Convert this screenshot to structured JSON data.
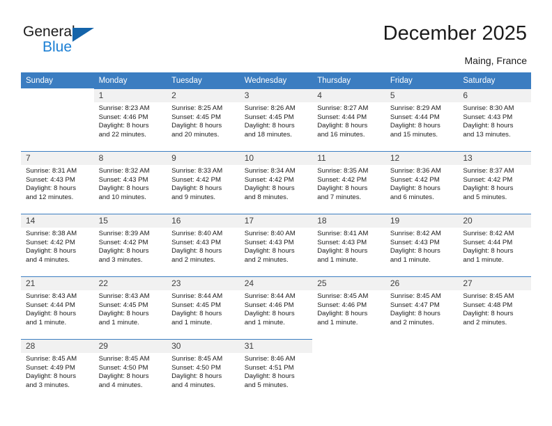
{
  "brand": {
    "name_part1": "General",
    "name_part2": "Blue",
    "triangle_color": "#1464aa",
    "blue_color": "#1b7fd4"
  },
  "header": {
    "title": "December 2025",
    "location": "Maing, France"
  },
  "theme": {
    "header_row_bg": "#3b7dc1",
    "day_number_bg": "#f1f1f1",
    "text_color": "#1b1b1b"
  },
  "weekdays": [
    "Sunday",
    "Monday",
    "Tuesday",
    "Wednesday",
    "Thursday",
    "Friday",
    "Saturday"
  ],
  "weeks": [
    [
      {
        "day": "",
        "sunrise": "",
        "sunset": "",
        "daylight1": "",
        "daylight2": "",
        "empty": true
      },
      {
        "day": "1",
        "sunrise": "Sunrise: 8:23 AM",
        "sunset": "Sunset: 4:46 PM",
        "daylight1": "Daylight: 8 hours",
        "daylight2": "and 22 minutes.",
        "empty": false
      },
      {
        "day": "2",
        "sunrise": "Sunrise: 8:25 AM",
        "sunset": "Sunset: 4:45 PM",
        "daylight1": "Daylight: 8 hours",
        "daylight2": "and 20 minutes.",
        "empty": false
      },
      {
        "day": "3",
        "sunrise": "Sunrise: 8:26 AM",
        "sunset": "Sunset: 4:45 PM",
        "daylight1": "Daylight: 8 hours",
        "daylight2": "and 18 minutes.",
        "empty": false
      },
      {
        "day": "4",
        "sunrise": "Sunrise: 8:27 AM",
        "sunset": "Sunset: 4:44 PM",
        "daylight1": "Daylight: 8 hours",
        "daylight2": "and 16 minutes.",
        "empty": false
      },
      {
        "day": "5",
        "sunrise": "Sunrise: 8:29 AM",
        "sunset": "Sunset: 4:44 PM",
        "daylight1": "Daylight: 8 hours",
        "daylight2": "and 15 minutes.",
        "empty": false
      },
      {
        "day": "6",
        "sunrise": "Sunrise: 8:30 AM",
        "sunset": "Sunset: 4:43 PM",
        "daylight1": "Daylight: 8 hours",
        "daylight2": "and 13 minutes.",
        "empty": false
      }
    ],
    [
      {
        "day": "7",
        "sunrise": "Sunrise: 8:31 AM",
        "sunset": "Sunset: 4:43 PM",
        "daylight1": "Daylight: 8 hours",
        "daylight2": "and 12 minutes.",
        "empty": false
      },
      {
        "day": "8",
        "sunrise": "Sunrise: 8:32 AM",
        "sunset": "Sunset: 4:43 PM",
        "daylight1": "Daylight: 8 hours",
        "daylight2": "and 10 minutes.",
        "empty": false
      },
      {
        "day": "9",
        "sunrise": "Sunrise: 8:33 AM",
        "sunset": "Sunset: 4:42 PM",
        "daylight1": "Daylight: 8 hours",
        "daylight2": "and 9 minutes.",
        "empty": false
      },
      {
        "day": "10",
        "sunrise": "Sunrise: 8:34 AM",
        "sunset": "Sunset: 4:42 PM",
        "daylight1": "Daylight: 8 hours",
        "daylight2": "and 8 minutes.",
        "empty": false
      },
      {
        "day": "11",
        "sunrise": "Sunrise: 8:35 AM",
        "sunset": "Sunset: 4:42 PM",
        "daylight1": "Daylight: 8 hours",
        "daylight2": "and 7 minutes.",
        "empty": false
      },
      {
        "day": "12",
        "sunrise": "Sunrise: 8:36 AM",
        "sunset": "Sunset: 4:42 PM",
        "daylight1": "Daylight: 8 hours",
        "daylight2": "and 6 minutes.",
        "empty": false
      },
      {
        "day": "13",
        "sunrise": "Sunrise: 8:37 AM",
        "sunset": "Sunset: 4:42 PM",
        "daylight1": "Daylight: 8 hours",
        "daylight2": "and 5 minutes.",
        "empty": false
      }
    ],
    [
      {
        "day": "14",
        "sunrise": "Sunrise: 8:38 AM",
        "sunset": "Sunset: 4:42 PM",
        "daylight1": "Daylight: 8 hours",
        "daylight2": "and 4 minutes.",
        "empty": false
      },
      {
        "day": "15",
        "sunrise": "Sunrise: 8:39 AM",
        "sunset": "Sunset: 4:42 PM",
        "daylight1": "Daylight: 8 hours",
        "daylight2": "and 3 minutes.",
        "empty": false
      },
      {
        "day": "16",
        "sunrise": "Sunrise: 8:40 AM",
        "sunset": "Sunset: 4:43 PM",
        "daylight1": "Daylight: 8 hours",
        "daylight2": "and 2 minutes.",
        "empty": false
      },
      {
        "day": "17",
        "sunrise": "Sunrise: 8:40 AM",
        "sunset": "Sunset: 4:43 PM",
        "daylight1": "Daylight: 8 hours",
        "daylight2": "and 2 minutes.",
        "empty": false
      },
      {
        "day": "18",
        "sunrise": "Sunrise: 8:41 AM",
        "sunset": "Sunset: 4:43 PM",
        "daylight1": "Daylight: 8 hours",
        "daylight2": "and 1 minute.",
        "empty": false
      },
      {
        "day": "19",
        "sunrise": "Sunrise: 8:42 AM",
        "sunset": "Sunset: 4:43 PM",
        "daylight1": "Daylight: 8 hours",
        "daylight2": "and 1 minute.",
        "empty": false
      },
      {
        "day": "20",
        "sunrise": "Sunrise: 8:42 AM",
        "sunset": "Sunset: 4:44 PM",
        "daylight1": "Daylight: 8 hours",
        "daylight2": "and 1 minute.",
        "empty": false
      }
    ],
    [
      {
        "day": "21",
        "sunrise": "Sunrise: 8:43 AM",
        "sunset": "Sunset: 4:44 PM",
        "daylight1": "Daylight: 8 hours",
        "daylight2": "and 1 minute.",
        "empty": false
      },
      {
        "day": "22",
        "sunrise": "Sunrise: 8:43 AM",
        "sunset": "Sunset: 4:45 PM",
        "daylight1": "Daylight: 8 hours",
        "daylight2": "and 1 minute.",
        "empty": false
      },
      {
        "day": "23",
        "sunrise": "Sunrise: 8:44 AM",
        "sunset": "Sunset: 4:45 PM",
        "daylight1": "Daylight: 8 hours",
        "daylight2": "and 1 minute.",
        "empty": false
      },
      {
        "day": "24",
        "sunrise": "Sunrise: 8:44 AM",
        "sunset": "Sunset: 4:46 PM",
        "daylight1": "Daylight: 8 hours",
        "daylight2": "and 1 minute.",
        "empty": false
      },
      {
        "day": "25",
        "sunrise": "Sunrise: 8:45 AM",
        "sunset": "Sunset: 4:46 PM",
        "daylight1": "Daylight: 8 hours",
        "daylight2": "and 1 minute.",
        "empty": false
      },
      {
        "day": "26",
        "sunrise": "Sunrise: 8:45 AM",
        "sunset": "Sunset: 4:47 PM",
        "daylight1": "Daylight: 8 hours",
        "daylight2": "and 2 minutes.",
        "empty": false
      },
      {
        "day": "27",
        "sunrise": "Sunrise: 8:45 AM",
        "sunset": "Sunset: 4:48 PM",
        "daylight1": "Daylight: 8 hours",
        "daylight2": "and 2 minutes.",
        "empty": false
      }
    ],
    [
      {
        "day": "28",
        "sunrise": "Sunrise: 8:45 AM",
        "sunset": "Sunset: 4:49 PM",
        "daylight1": "Daylight: 8 hours",
        "daylight2": "and 3 minutes.",
        "empty": false
      },
      {
        "day": "29",
        "sunrise": "Sunrise: 8:45 AM",
        "sunset": "Sunset: 4:50 PM",
        "daylight1": "Daylight: 8 hours",
        "daylight2": "and 4 minutes.",
        "empty": false
      },
      {
        "day": "30",
        "sunrise": "Sunrise: 8:45 AM",
        "sunset": "Sunset: 4:50 PM",
        "daylight1": "Daylight: 8 hours",
        "daylight2": "and 4 minutes.",
        "empty": false
      },
      {
        "day": "31",
        "sunrise": "Sunrise: 8:46 AM",
        "sunset": "Sunset: 4:51 PM",
        "daylight1": "Daylight: 8 hours",
        "daylight2": "and 5 minutes.",
        "empty": false
      },
      {
        "day": "",
        "sunrise": "",
        "sunset": "",
        "daylight1": "",
        "daylight2": "",
        "empty": true
      },
      {
        "day": "",
        "sunrise": "",
        "sunset": "",
        "daylight1": "",
        "daylight2": "",
        "empty": true
      },
      {
        "day": "",
        "sunrise": "",
        "sunset": "",
        "daylight1": "",
        "daylight2": "",
        "empty": true
      }
    ]
  ]
}
